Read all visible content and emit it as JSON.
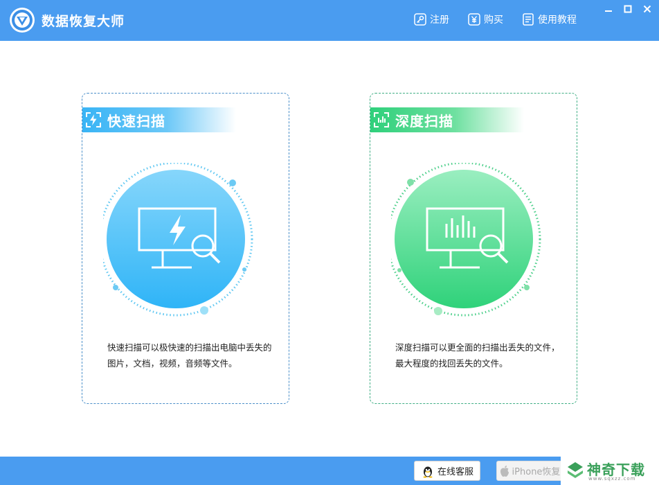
{
  "app": {
    "title": "数据恢复大师"
  },
  "header": {
    "links": [
      {
        "label": "注册",
        "icon": "key-icon"
      },
      {
        "label": "购买",
        "icon": "yen-icon"
      },
      {
        "label": "使用教程",
        "icon": "document-icon"
      }
    ]
  },
  "window_controls": [
    "minimize",
    "maximize",
    "close"
  ],
  "cards": {
    "quick": {
      "title": "快速扫描",
      "description": "快速扫描可以极快速的扫描出电脑中丢失的图片，文档，视频，音频等文件。",
      "accent": "#39b4f5"
    },
    "deep": {
      "title": "深度扫描",
      "description": "深度扫描可以更全面的扫描出丢失的文件，最大程度的找回丢失的文件。",
      "accent": "#2fd07b"
    }
  },
  "footer": {
    "service_label": "在线客服",
    "iphone_label": "iPhone恢复"
  },
  "watermark": {
    "text": "神奇下载",
    "url": "www.sqxzz.com"
  },
  "colors": {
    "bar": "#4a9cf0",
    "blue_dash": "#4a8fc9",
    "green_dash": "#3fae84"
  }
}
